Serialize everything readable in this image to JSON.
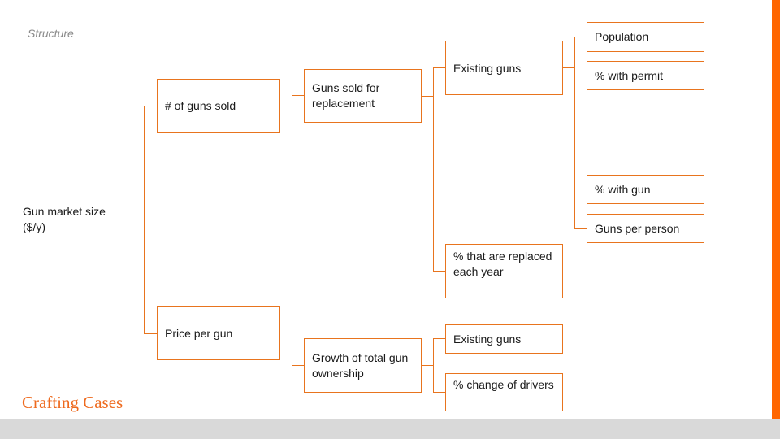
{
  "slide": {
    "title": "Structure",
    "brand": "Crafting Cases",
    "accent_color": "#ff6600",
    "line_color": "#e8741e",
    "footer_color": "#d9d9d9"
  },
  "tree": {
    "root": {
      "label": "Gun market size ($/y)"
    },
    "level1": [
      {
        "label": "# of guns sold"
      },
      {
        "label": "Price per gun"
      }
    ],
    "level2": [
      {
        "label": "Guns sold for replacement"
      },
      {
        "label": "Growth of total gun ownership"
      }
    ],
    "level3": [
      {
        "label": "Existing guns"
      },
      {
        "label": "% that are replaced each year"
      },
      {
        "label": "Existing guns"
      },
      {
        "label": "% change of drivers"
      }
    ],
    "level4": [
      {
        "label": "Population"
      },
      {
        "label": "% with permit"
      },
      {
        "label": "% with gun"
      },
      {
        "label": "Guns per person"
      }
    ]
  }
}
